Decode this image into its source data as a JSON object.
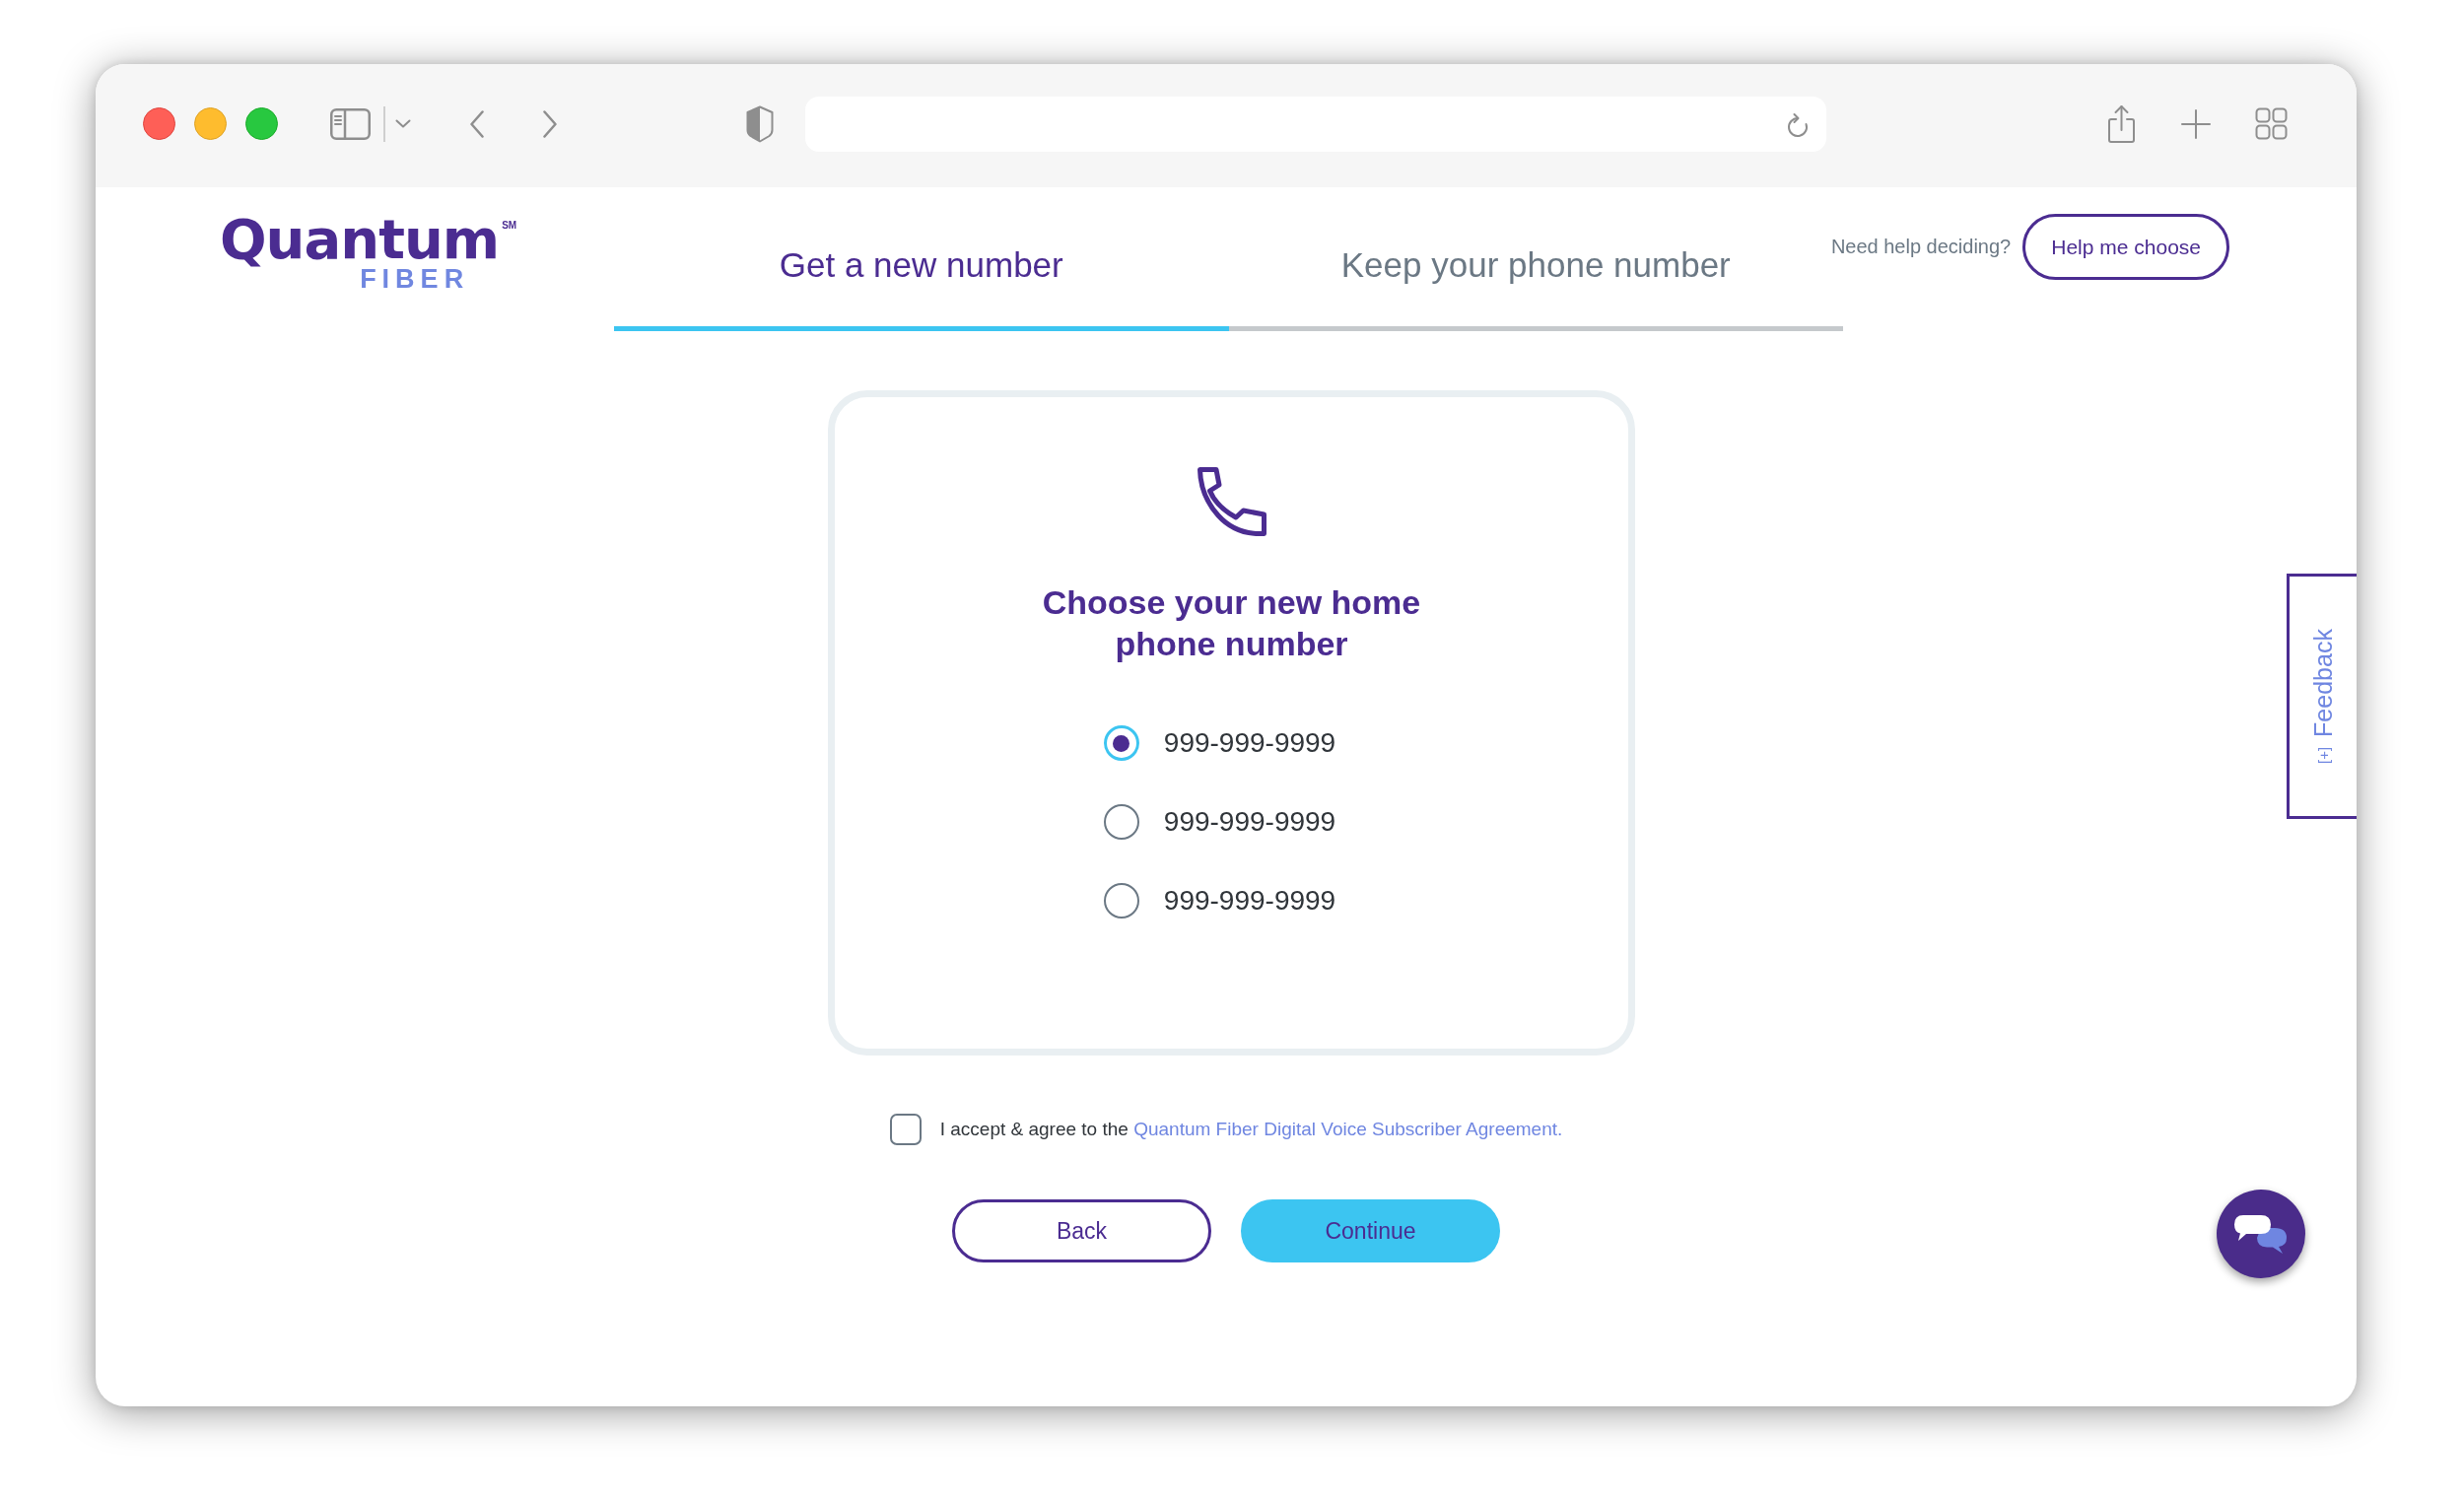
{
  "logo": {
    "name": "Quantum",
    "mark": "SM",
    "subtitle": "FIBER"
  },
  "tabs": [
    {
      "label": "Get a new number",
      "selected": true
    },
    {
      "label": "Keep your phone number",
      "selected": false
    }
  ],
  "help": {
    "prompt": "Need help deciding?",
    "button": "Help me choose"
  },
  "card": {
    "title": "Choose your new home phone number",
    "options": [
      {
        "label": "999-999-9999",
        "selected": true
      },
      {
        "label": "999-999-9999",
        "selected": false
      },
      {
        "label": "999-999-9999",
        "selected": false
      }
    ]
  },
  "agreement": {
    "checked": false,
    "text": "I accept & agree to the",
    "link": "Quantum Fiber Digital Voice Subscriber Agreement."
  },
  "buttons": [
    {
      "label": "Back",
      "kind": "outline"
    },
    {
      "label": "Continue",
      "kind": "primary"
    }
  ],
  "feedback": {
    "marker": "[+]",
    "label": "Feedback"
  }
}
